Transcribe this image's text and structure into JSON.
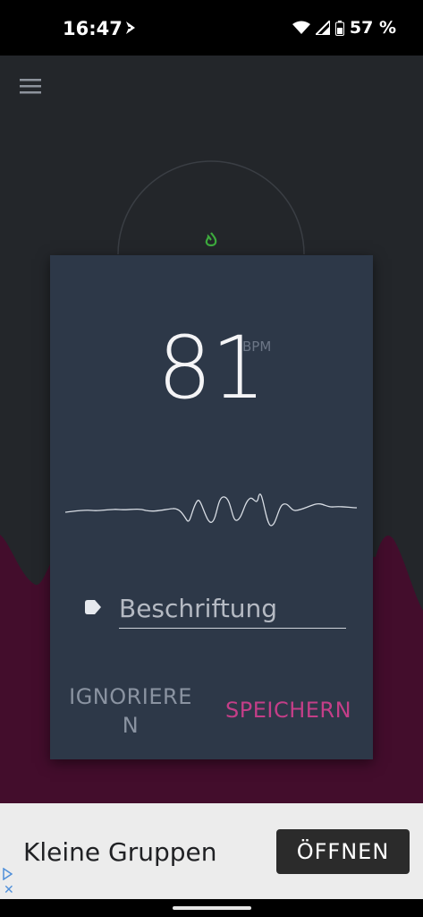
{
  "status_bar": {
    "time": "16:47",
    "battery_text": "57 %"
  },
  "measurement": {
    "value": "81",
    "unit": "BPM"
  },
  "label_field": {
    "placeholder": "Beschriftung"
  },
  "actions": {
    "ignore": "IGNORIERE N",
    "save": "SPEICHERN"
  },
  "ad": {
    "title": "Kleine Gruppen",
    "button": "ÖFFNEN"
  },
  "colors": {
    "accent": "#c43e88",
    "background_wave": "#430d2c",
    "dialog": "#2d3848",
    "flame": "#3daa3d"
  },
  "icons": {
    "menu": "hamburger-menu-icon",
    "flame": "flame-icon",
    "tag": "tag-icon",
    "ad_choices": "ad-choices-icon",
    "ad_close": "close-icon"
  }
}
